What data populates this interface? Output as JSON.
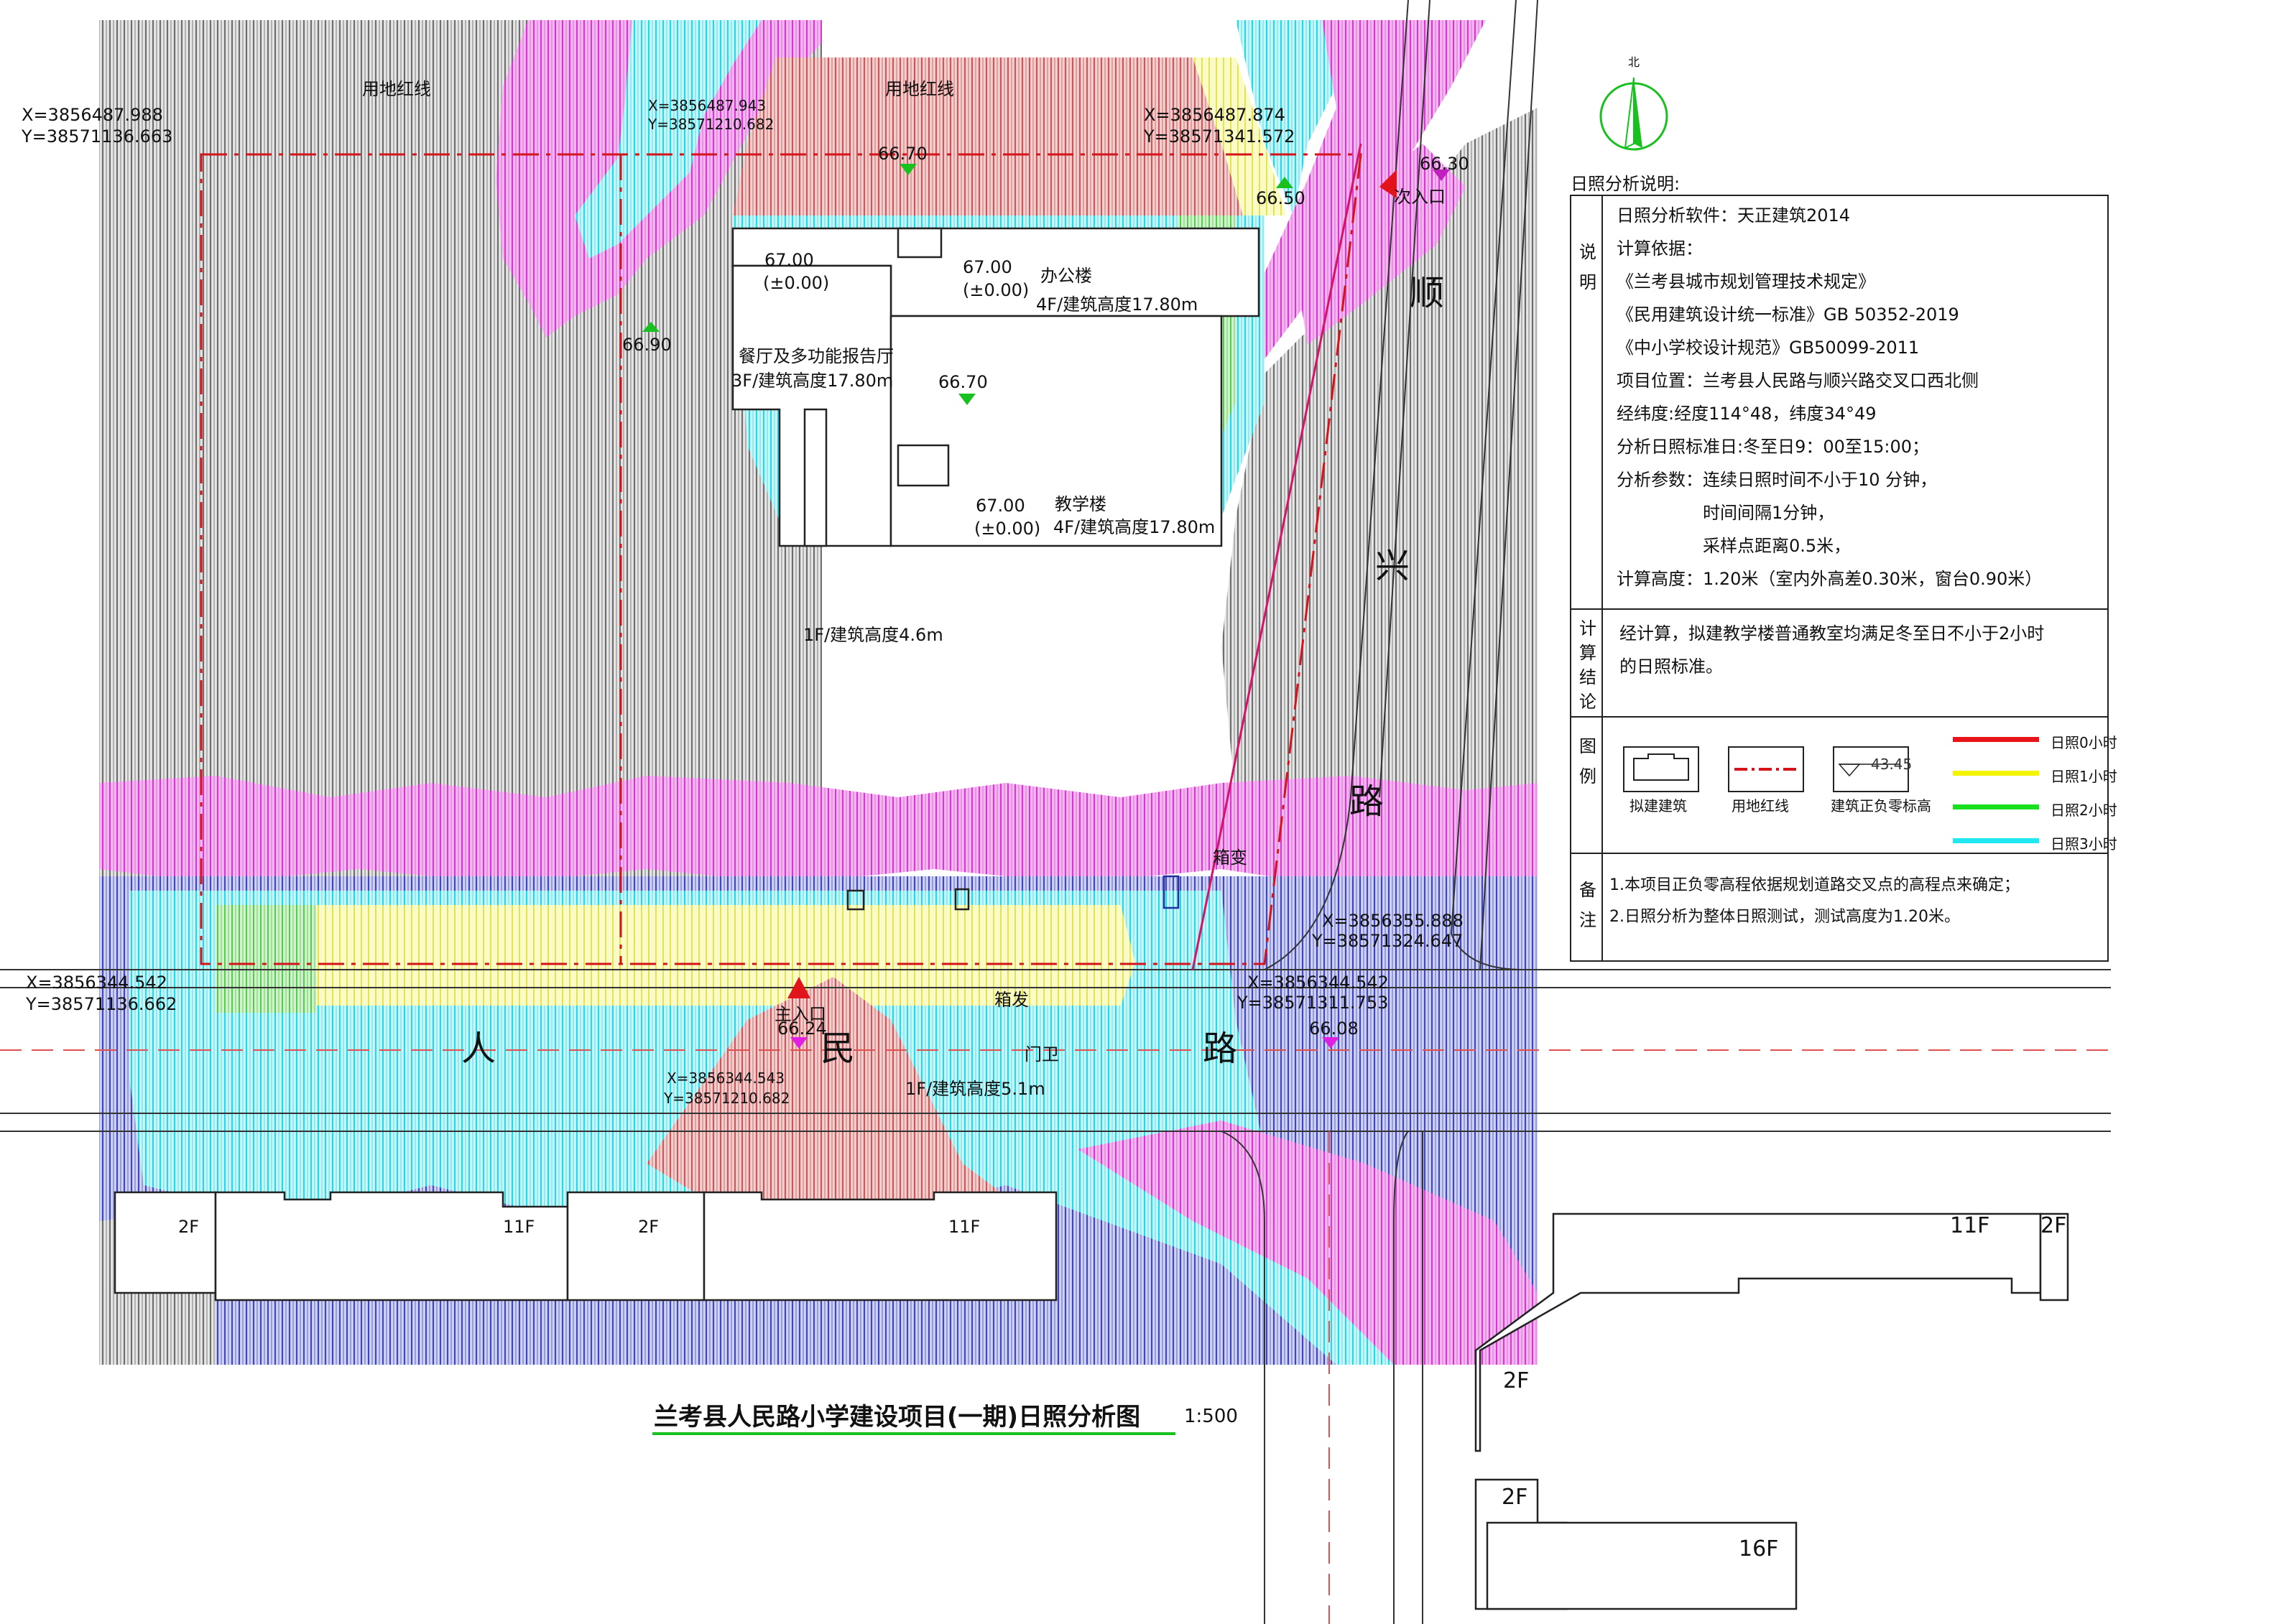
{
  "title": "兰考县人民路小学建设项目(一期)日照分析图",
  "scale": "1:500",
  "north_label": "北",
  "panel": {
    "heading": "日照分析说明:",
    "sections": {
      "desc": "说明",
      "conclusion": "计算结论",
      "legend": "图例",
      "notes": "备注"
    },
    "desc_lines": [
      "日照分析软件：天正建筑2014",
      "计算依据：",
      "《兰考县城市规划管理技术规定》",
      "《民用建筑设计统一标准》GB 50352-2019",
      "《中小学校设计规范》GB50099-2011",
      "项目位置：兰考县人民路与顺兴路交叉口西北侧",
      "经纬度:经度114°48，纬度34°49",
      "分析日照标准日:冬至日9：00至15:00；",
      "分析参数：连续日照时间不小于10 分钟，",
      "时间间隔1分钟，",
      "采样点距离0.5米，",
      "计算高度：1.20米（室内外高差0.30米，窗台0.90米）"
    ],
    "conclusion_lines": [
      "经计算，拟建教学楼普通教室均满足冬至日不小于2小时",
      "的日照标准。"
    ],
    "legend": {
      "building": "拟建建筑",
      "red_line": "用地红线",
      "elev_sample": "43.45",
      "elev": "建筑正负零标高",
      "hours": [
        {
          "label": "日照0小时",
          "color": "#e8141a"
        },
        {
          "label": "日照1小时",
          "color": "#f4f400"
        },
        {
          "label": "日照2小时",
          "color": "#18e020"
        },
        {
          "label": "日照3小时",
          "color": "#20e8f0"
        }
      ]
    },
    "notes_lines": [
      "1.本项目正负零高程依据规划道路交叉点的高程点来确定；",
      "2.日照分析为整体日照测试，测试高度为1.20米。"
    ]
  },
  "map": {
    "coords": {
      "nw": [
        "X=3856487.988",
        "Y=38571136.663"
      ],
      "n_mid": [
        "X=3856487.943",
        "Y=38571210.682"
      ],
      "ne": [
        "X=3856487.874",
        "Y=38571341.572"
      ],
      "e1": [
        "X=3856355.888",
        "Y=38571324.647"
      ],
      "e2": [
        "X=3856344.542",
        "Y=38571311.753"
      ],
      "sw": [
        "X=3856344.542",
        "Y=38571136.662"
      ],
      "s_mid": [
        "X=3856344.543",
        "Y=38571210.682"
      ]
    },
    "redline_label": "用地红线",
    "redline_label_2": "用地红线",
    "entrance_side": "次入口",
    "entrance_main": "主入口",
    "elevations": {
      "top": "66.70",
      "ne_right": "66.30",
      "ne": "66.50",
      "west": "66.90",
      "center": "66.70",
      "main_entrance": "66.24",
      "east": "66.08"
    },
    "buildings": {
      "office": {
        "name": "办公楼",
        "info": "4F/建筑高度17.80m",
        "elev": "67.00",
        "zero": "(±0.00)"
      },
      "dining": {
        "name": "餐厅及多功能报告厅",
        "info": "3F/建筑高度17.80m",
        "elev": "67.00",
        "zero": "(±0.00)"
      },
      "teaching": {
        "name": "教学楼",
        "info": "4F/建筑高度17.80m",
        "elev": "67.00",
        "zero": "(±0.00)"
      },
      "single_story": "1F/建筑高度4.6m",
      "gate": {
        "name": "门卫",
        "info": "1F/建筑高度5.1m"
      },
      "box_substation": "箱变",
      "box_substation_2": "箱发"
    },
    "roads": {
      "shunxing": [
        "顺",
        "兴",
        "路"
      ],
      "renmin": [
        "人",
        "民",
        "路"
      ]
    },
    "floors": {
      "s1": "2F",
      "s2": "11F",
      "s3": "2F",
      "s4": "11F",
      "se1": "11F",
      "se2": "2F",
      "se3": "2F",
      "se4": "2F",
      "se5": "16F"
    }
  }
}
